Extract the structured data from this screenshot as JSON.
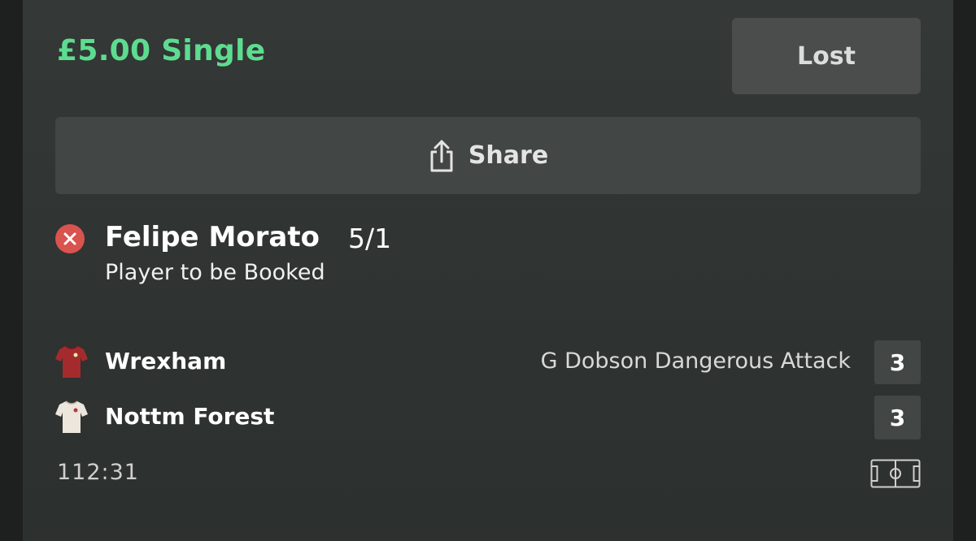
{
  "bet": {
    "title": "£5.00 Single",
    "status_label": "Lost",
    "title_color": "#5ddc8f"
  },
  "share": {
    "label": "Share",
    "icon": "share-icon"
  },
  "selection": {
    "status_icon": "cross-circle-icon",
    "status_color": "#d9534f",
    "name": "Felipe Morato",
    "odds": "5/1",
    "market": "Player to be Booked"
  },
  "match": {
    "home": {
      "name": "Wrexham",
      "score": "3",
      "shirt_icon": "red-shirt-icon",
      "shirt_color": "#a32b2e"
    },
    "away": {
      "name": "Nottm Forest",
      "score": "3",
      "shirt_icon": "white-shirt-icon",
      "shirt_color": "#ece6dc"
    },
    "last_event": "G Dobson Dangerous Attack",
    "clock": "112:31",
    "pitch_icon": "pitch-icon"
  }
}
